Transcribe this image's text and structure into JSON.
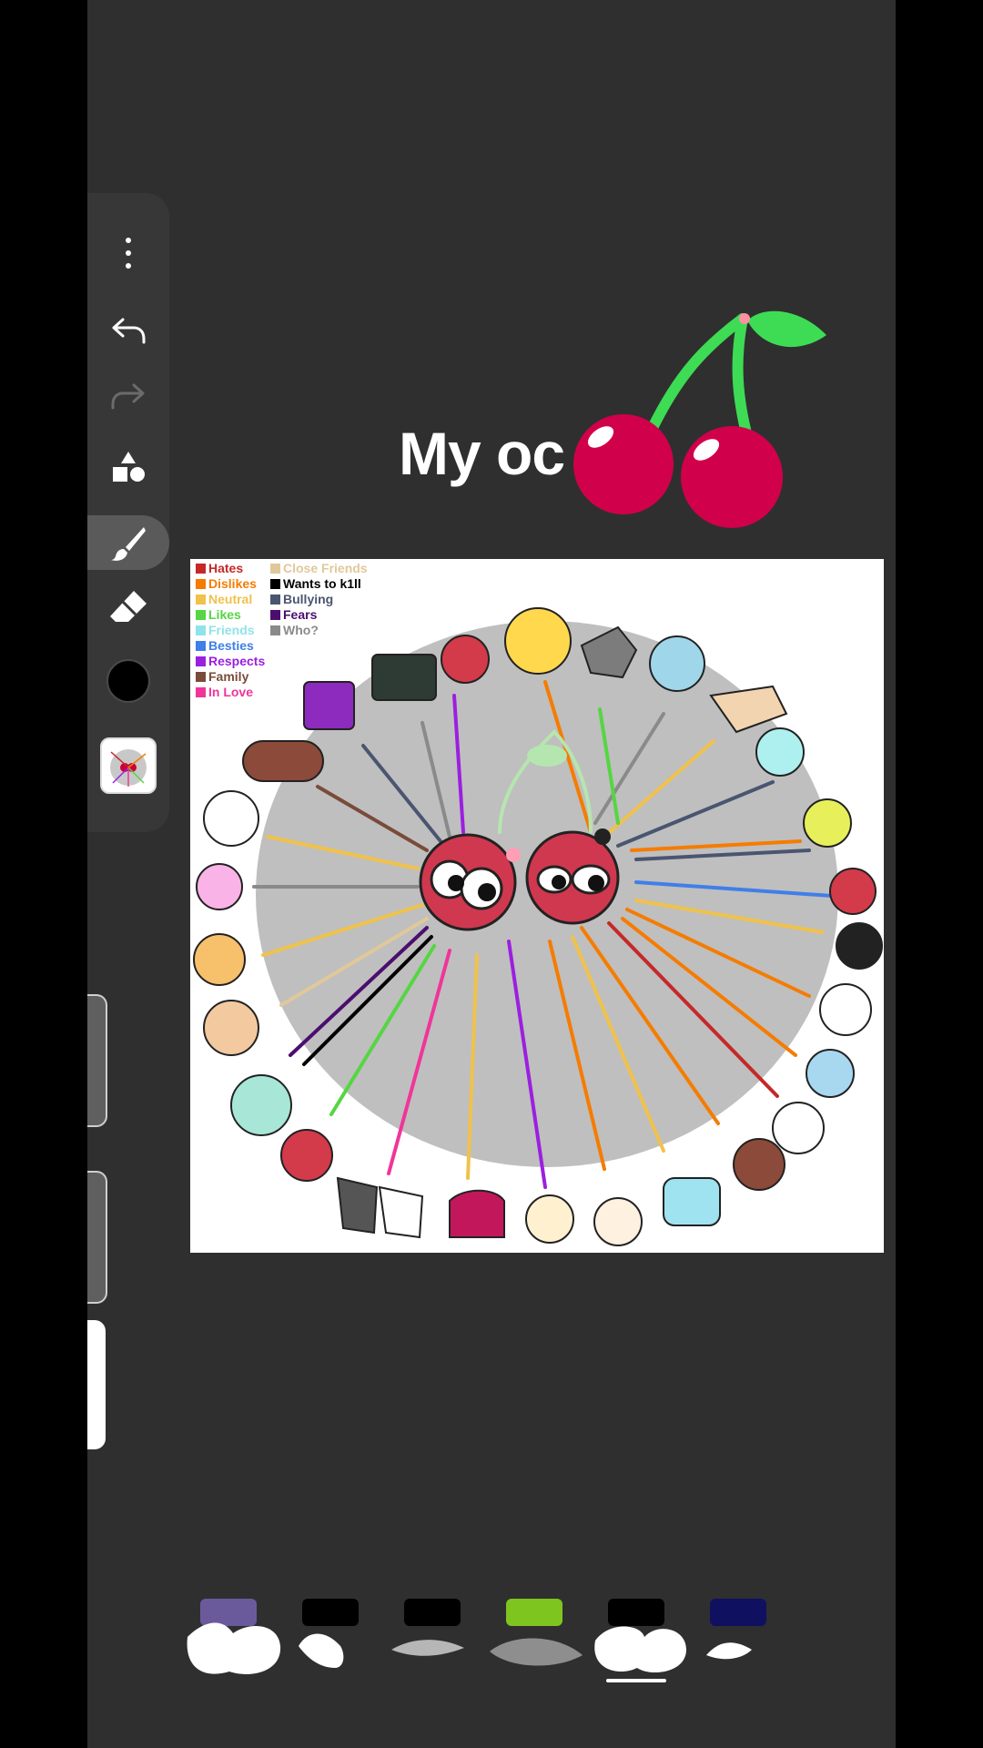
{
  "title": {
    "text": "My oc"
  },
  "toolbar": {
    "items": [
      {
        "name": "more-menu-icon"
      },
      {
        "name": "undo-icon"
      },
      {
        "name": "redo-icon"
      },
      {
        "name": "shapes-icon"
      },
      {
        "name": "brush-icon",
        "selected": true
      },
      {
        "name": "eraser-icon"
      },
      {
        "name": "color-swatch",
        "color": "#000000"
      },
      {
        "name": "layer-thumbnail"
      }
    ]
  },
  "legend_left": {
    "items": [
      {
        "label": "Hates",
        "color": "#c62828"
      },
      {
        "label": "Dislikes",
        "color": "#f57c00"
      },
      {
        "label": "Neutral",
        "color": "#f0c24b"
      },
      {
        "label": "Likes",
        "color": "#55d642"
      },
      {
        "label": "Friends",
        "color": "#8fe3ea"
      },
      {
        "label": "Besties",
        "color": "#3f7fe8"
      },
      {
        "label": "Respects",
        "color": "#9c1fe0"
      },
      {
        "label": "Family",
        "color": "#7a4b3a"
      },
      {
        "label": "In Love",
        "color": "#f0359a"
      }
    ]
  },
  "legend_right": {
    "items": [
      {
        "label": "Close Friends",
        "color": "#e0c89a"
      },
      {
        "label": "Wants to k1ll",
        "color": "#000000"
      },
      {
        "label": "Bullying",
        "color": "#4a5570"
      },
      {
        "label": "Fears",
        "color": "#4b0e6e"
      },
      {
        "label": "Who?",
        "color": "#8a8a8a"
      }
    ]
  },
  "brushes": {
    "items": [
      {
        "name": "brush-1",
        "top_color": "#6b5a9b"
      },
      {
        "name": "brush-2",
        "top_color": "#000000"
      },
      {
        "name": "brush-3",
        "top_color": "#000000"
      },
      {
        "name": "brush-4",
        "top_color": "#7fc51f"
      },
      {
        "name": "brush-5",
        "top_color": "#000000",
        "selected": true
      },
      {
        "name": "brush-6",
        "top_color": "#0f1160"
      }
    ]
  },
  "colors": {
    "background": "#2f2f30",
    "toolbar": "#373738",
    "cherry_red": "#d1004a",
    "cherry_stem": "#3ddc54"
  }
}
